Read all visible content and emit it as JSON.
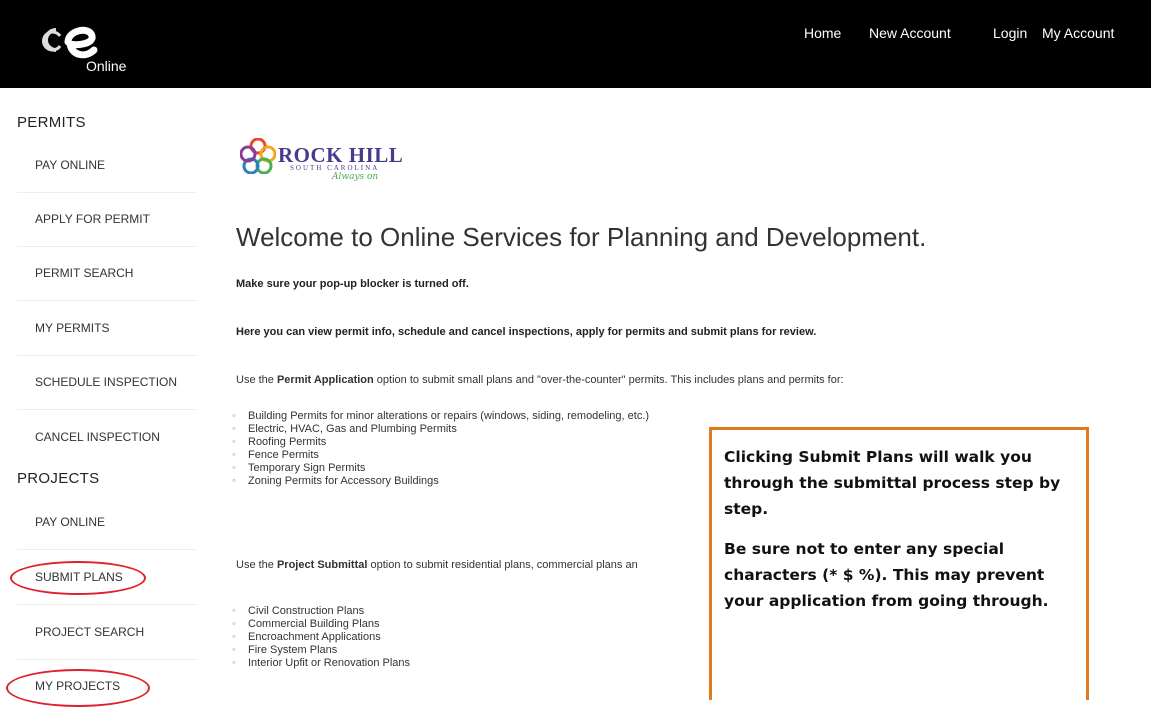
{
  "header": {
    "logo_text": "Online",
    "nav": [
      "Home",
      "New Account",
      "Login",
      "My Account"
    ]
  },
  "sidebar": {
    "permits_heading": "PERMITS",
    "permits_items": [
      "PAY ONLINE",
      "APPLY FOR PERMIT",
      "PERMIT SEARCH",
      "MY PERMITS",
      "SCHEDULE INSPECTION",
      "CANCEL INSPECTION"
    ],
    "projects_heading": "PROJECTS",
    "projects_items": [
      "PAY ONLINE",
      "SUBMIT PLANS",
      "PROJECT SEARCH",
      "MY PROJECTS"
    ]
  },
  "brand": {
    "name": "ROCK HILL",
    "state": "SOUTH CAROLINA",
    "tagline": "Always on"
  },
  "main": {
    "welcome": "Welcome to Online Services for Planning and Development.",
    "popup_note": "Make sure your pop-up blocker is turned off.",
    "intro": "Here you can view permit info, schedule and cancel inspections, apply for permits and submit plans for review.",
    "permit_app_pre": "Use the ",
    "permit_app_bold": "Permit Application",
    "permit_app_post": " option to submit small plans and \"over-the-counter\" permits. This includes plans and permits for:",
    "permit_list": [
      "Building Permits for minor alterations or repairs (windows, siding, remodeling, etc.)",
      "Electric, HVAC, Gas and Plumbing Permits",
      "Roofing Permits",
      "Fence Permits",
      "Temporary Sign Permits",
      "Zoning Permits for Accessory Buildings"
    ],
    "project_pre": "Use the ",
    "project_bold": "Project Submittal",
    "project_post": " option to submit residential plans, commercial plans an",
    "project_list": [
      "Civil Construction Plans",
      "Commercial Building Plans",
      "Encroachment Applications",
      "Fire System Plans",
      "Interior Upfit or Renovation Plans"
    ]
  },
  "callout": {
    "line1": "Clicking Submit Plans will walk you through the submittal process step by step.",
    "line2": "Be sure not to enter any special characters (* $ %). This may prevent your application from going through."
  },
  "colors": {
    "topbar": "#000000",
    "callout_border": "#e07a1f",
    "highlight_oval": "#e0202b"
  }
}
